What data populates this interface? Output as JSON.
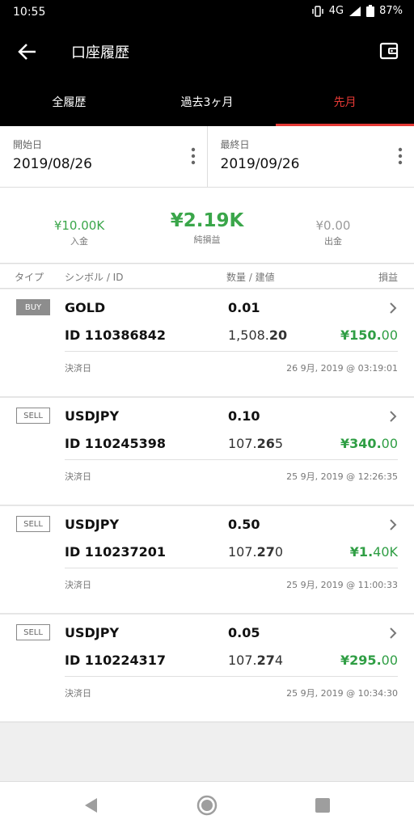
{
  "status": {
    "time": "10:55",
    "network": "4G",
    "battery": "87%"
  },
  "appbar": {
    "title": "口座履歴"
  },
  "tabs": [
    "全履歴",
    "過去3ヶ月",
    "先月"
  ],
  "dates": {
    "start": {
      "label": "開始日",
      "value": "2019/08/26"
    },
    "end": {
      "label": "最終日",
      "value": "2019/09/26"
    }
  },
  "summary": {
    "deposit": {
      "amount": "¥10.00K",
      "caption": "入金"
    },
    "net": {
      "amount": "¥2.19K",
      "caption": "純損益"
    },
    "withdrawal": {
      "amount": "¥0.00",
      "caption": "出金"
    }
  },
  "columns": {
    "type": "タイプ",
    "symbol": "シンボル / ID",
    "qty": "数量 / 建値",
    "pnl": "損益"
  },
  "trades": [
    {
      "type": "BUY",
      "symbol": "GOLD",
      "qty": "0.01",
      "id": "ID 110386842",
      "price_main": "1,508.",
      "price_bold": "20",
      "price_tail": "",
      "pnl_main": "¥150.",
      "pnl_frac": "00",
      "settle_label": "決済日",
      "settle_date": "26 9月, 2019 @ 03:19:01"
    },
    {
      "type": "SELL",
      "symbol": "USDJPY",
      "qty": "0.10",
      "id": "ID 110245398",
      "price_main": "107.",
      "price_bold": "26",
      "price_tail": "5",
      "pnl_main": "¥340.",
      "pnl_frac": "00",
      "settle_label": "決済日",
      "settle_date": "25 9月, 2019 @ 12:26:35"
    },
    {
      "type": "SELL",
      "symbol": "USDJPY",
      "qty": "0.50",
      "id": "ID 110237201",
      "price_main": "107.",
      "price_bold": "27",
      "price_tail": "0",
      "pnl_main": "¥1.",
      "pnl_frac": "40K",
      "settle_label": "決済日",
      "settle_date": "25 9月, 2019 @ 11:00:33"
    },
    {
      "type": "SELL",
      "symbol": "USDJPY",
      "qty": "0.05",
      "id": "ID 110224317",
      "price_main": "107.",
      "price_bold": "27",
      "price_tail": "4",
      "pnl_main": "¥295.",
      "pnl_frac": "00",
      "settle_label": "決済日",
      "settle_date": "25 9月, 2019 @ 10:34:30"
    }
  ],
  "icons": {
    "back": "arrow-left-icon",
    "wallet": "wallet-icon",
    "more": "kebab-icon",
    "chevron": "chevron-right-icon",
    "nav_back": "triangle-back-icon",
    "nav_home": "circle-home-icon",
    "nav_recents": "square-recents-icon"
  },
  "colors": {
    "accent": "#e53935",
    "profit": "#2f9e44"
  }
}
